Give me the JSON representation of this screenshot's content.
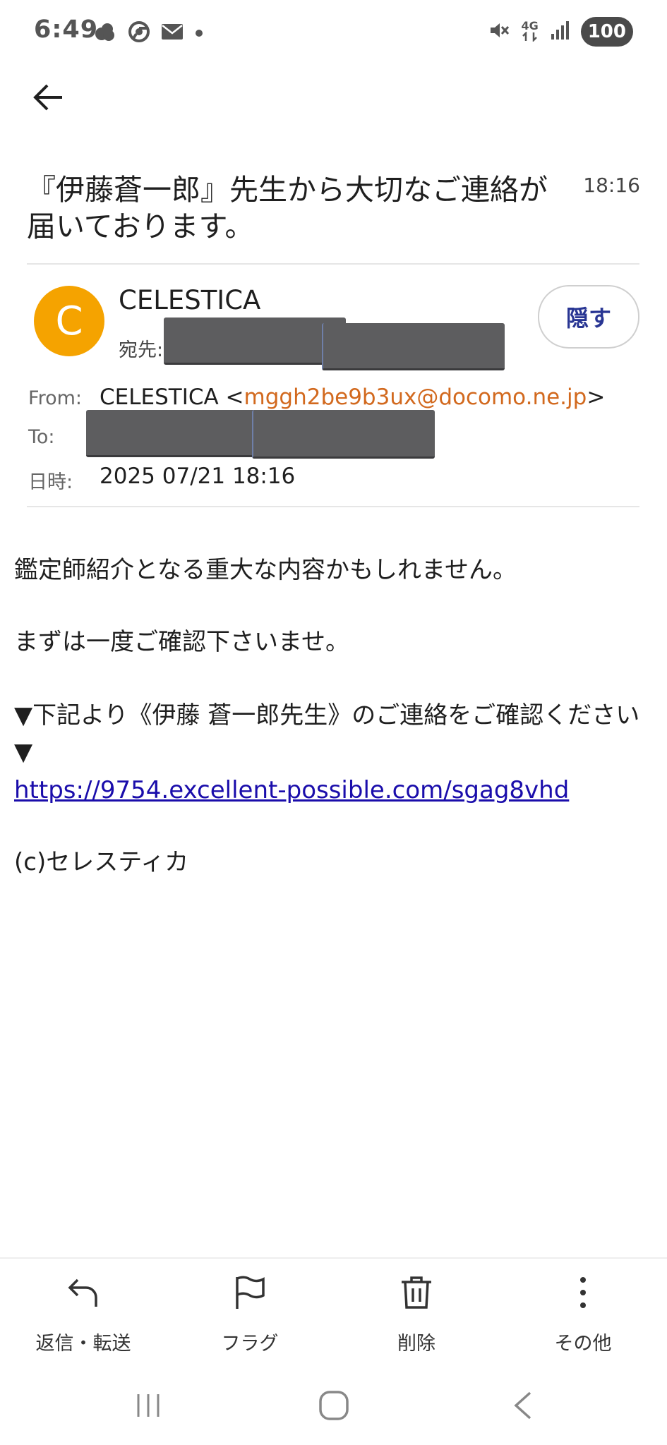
{
  "status_bar": {
    "time": "6:49",
    "network_label_top": "4G",
    "battery": "100"
  },
  "email": {
    "subject": "『伊藤蒼一郎』先生から大切なご連絡が届いております。",
    "time": "18:16",
    "sender_name": "CELESTICA",
    "avatar_letter": "C",
    "to_inline_label": "宛先:",
    "hide_button": "隠す",
    "from_label": "From:",
    "from_name": "CELESTICA <",
    "from_email": "mggh2be9b3ux@docomo.ne.jp",
    "from_close": ">",
    "to_label": "To:",
    "date_label": "日時:",
    "date_value": "2025 07/21 18:16"
  },
  "body": {
    "line1": "鑑定師紹介となる重大な内容かもしれません。",
    "line2": "まずは一度ご確認下さいませ。",
    "line3": "▼下記より《伊藤 蒼一郎先生》のご連絡をご確認ください▼",
    "link": "https://9754.excellent-possible.com/sgag8vhd",
    "footer": "(c)セレスティカ"
  },
  "toolbar": {
    "reply_label": "返信・転送",
    "flag_label": "フラグ",
    "delete_label": "削除",
    "more_label": "その他"
  },
  "icons": {
    "back": "arrow-left-icon",
    "reply": "reply-icon",
    "flag": "flag-icon",
    "delete": "trash-icon",
    "more": "more-vertical-icon",
    "nav_recents": "recents-icon",
    "nav_home": "home-icon",
    "nav_back": "nav-back-icon"
  },
  "colors": {
    "avatar": "#f5a300",
    "email_link": "#d2691e",
    "body_link": "#1a0dab",
    "hide_button_text": "#283593"
  }
}
